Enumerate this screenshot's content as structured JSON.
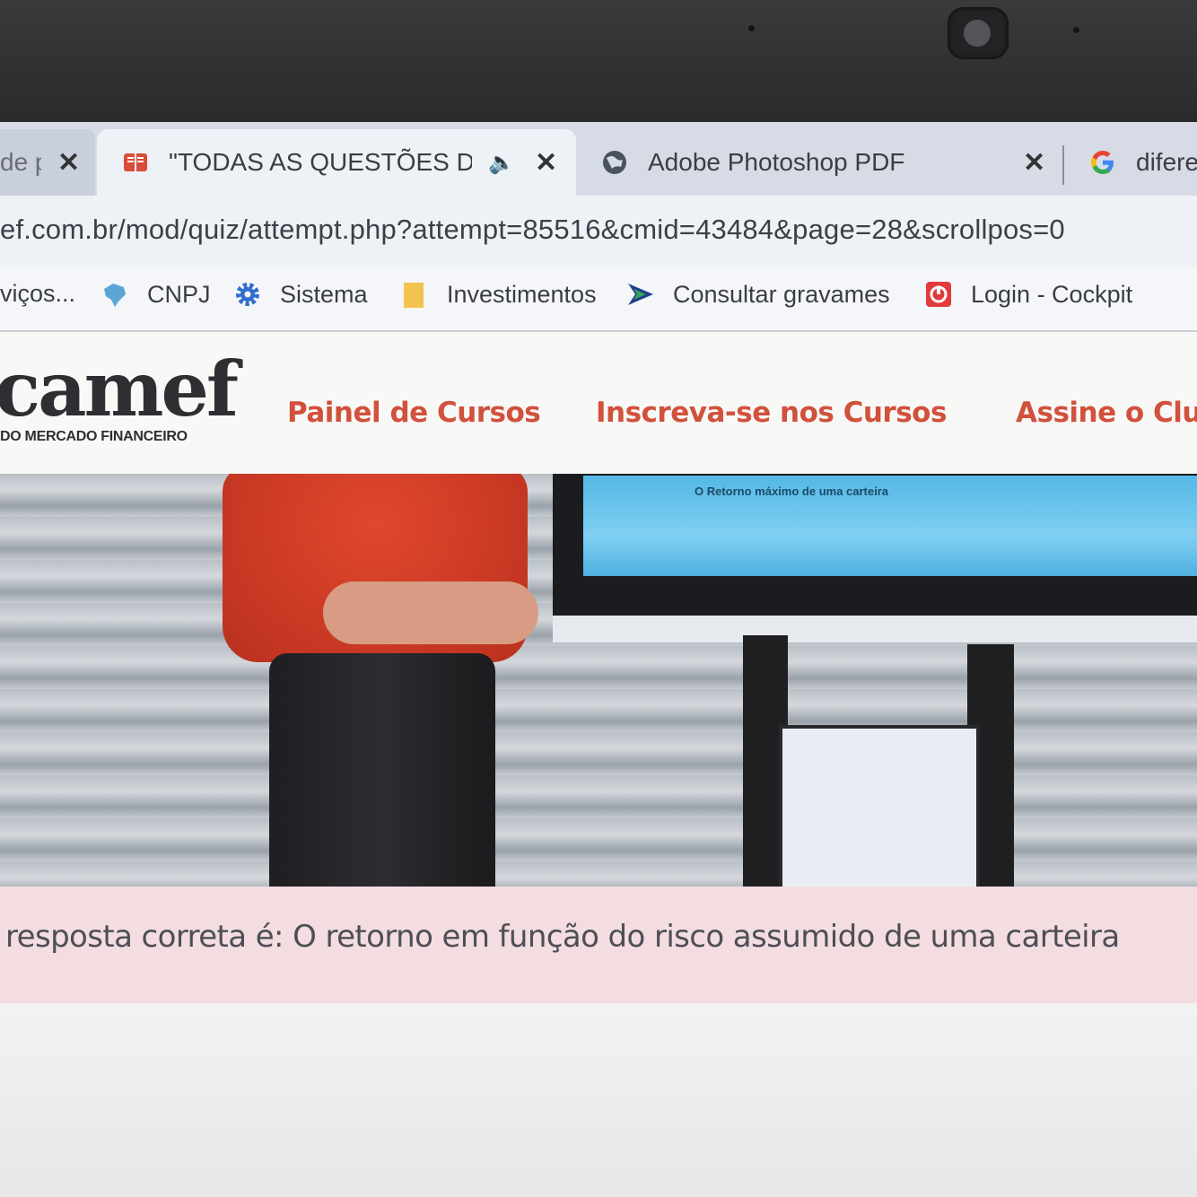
{
  "tabs": [
    {
      "title": "de p",
      "close": "✕"
    },
    {
      "title": "\"TODAS AS QUESTÕES DO M",
      "audio": "🔈",
      "close": "✕"
    },
    {
      "title": "Adobe Photoshop PDF",
      "close": "✕"
    },
    {
      "title": "difere"
    }
  ],
  "address": {
    "url": "ef.com.br/mod/quiz/attempt.php?attempt=85516&cmid=43484&page=28&scrollpos=0"
  },
  "bookmarks": [
    {
      "label": "viços...",
      "icon": "none"
    },
    {
      "label": "CNPJ",
      "icon": "brazil-map-icon"
    },
    {
      "label": "Sistema",
      "icon": "gear-icon"
    },
    {
      "label": "Investimentos",
      "icon": "folder-icon"
    },
    {
      "label": "Consultar gravames",
      "icon": "arrow-icon"
    },
    {
      "label": "Login - Cockpit",
      "icon": "cockpit-icon"
    }
  ],
  "site": {
    "logo": "camef",
    "logo_sub": "DO MERCADO FINANCEIRO",
    "nav": [
      "Painel de Cursos",
      "Inscreva-se nos Cursos",
      "Assine o Clu"
    ]
  },
  "video": {
    "screen_text": "O Retorno máximo de uma carteira"
  },
  "answer": {
    "text": "resposta correta é: O retorno em função do risco assumido de uma carteira"
  },
  "colors": {
    "accent": "#d1513c",
    "answer_bg": "#f3dde0",
    "tab_active": "#eef1f6"
  }
}
